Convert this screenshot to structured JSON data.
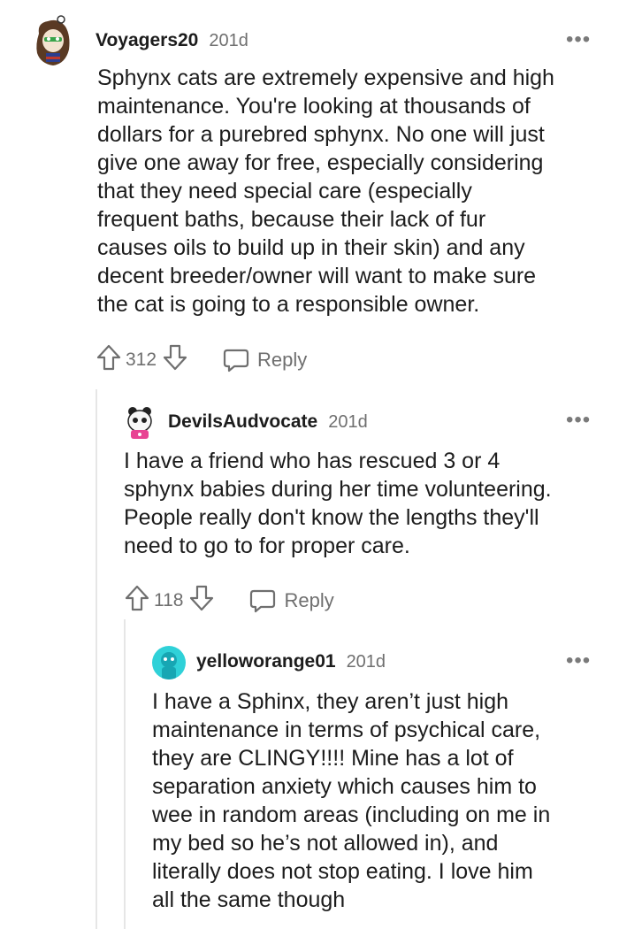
{
  "comments": [
    {
      "username": "Voyagers20",
      "time": "201d",
      "more": "•••",
      "body": "Sphynx cats are extremely expensive and high\nmaintenance. You're looking at thousands of\ndollars for a purebred sphynx. No one will just\ngive one away for free, especially considering\nthat they need special care (especially\nfrequent baths, because their lack of fur\ncauses oils to build up in their skin) and any\ndecent breeder/owner will want to make sure\nthe cat is going to a responsible owner.",
      "score": "312",
      "reply_label": "Reply"
    },
    {
      "username": "DevilsAudvocate",
      "time": "201d",
      "more": "•••",
      "body": "I have a friend who has rescued 3 or 4\nsphynx babies during her time volunteering.\nPeople really don't know the lengths they'll\nneed to go to for proper care.",
      "score": "118",
      "reply_label": "Reply"
    },
    {
      "username": "yelloworange01",
      "time": "201d",
      "more": "•••",
      "body": "I have a Sphinx, they aren’t just high\nmaintenance in terms of psychical care,\nthey are CLINGY!!!! Mine has a lot of\nseparation anxiety which causes him to\nwee in random areas (including on me in\nmy bed so he’s not allowed in), and\nliterally does not stop eating. I love him\nall the same though"
    }
  ],
  "icons": {
    "upvote": "arrow-up-outline",
    "downvote": "arrow-down-outline",
    "reply": "speech-bubble-outline",
    "more": "ellipsis-horizontal"
  },
  "colors": {
    "text": "#1c1c1c",
    "meta": "#6f6f6f",
    "thread_line": "#e6e6e6",
    "avatar_teal": "#2fd1d8"
  }
}
